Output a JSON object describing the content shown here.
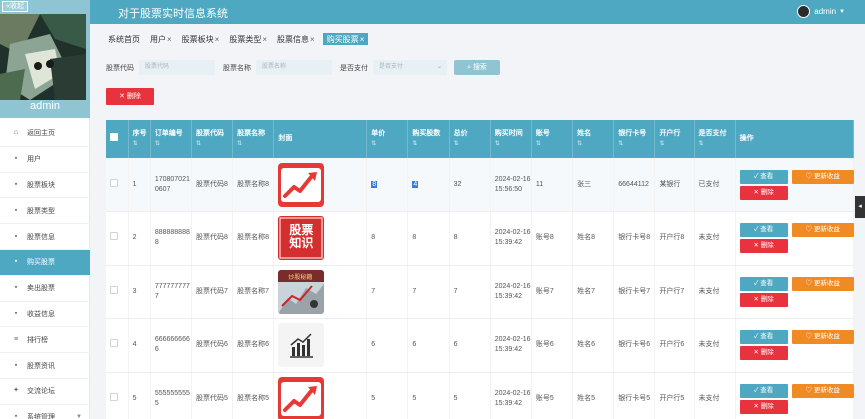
{
  "app": {
    "title": "对于股票实时信息系统",
    "user": "admin"
  },
  "sidebar": {
    "collapse_label": "«收起",
    "admin_name": "admin",
    "items": [
      {
        "label": "返回主页",
        "icon": "home-icon"
      },
      {
        "label": "用户",
        "icon": "user-icon"
      },
      {
        "label": "股票板块",
        "icon": "board-icon"
      },
      {
        "label": "股票类型",
        "icon": "type-icon"
      },
      {
        "label": "股票信息",
        "icon": "info-icon"
      },
      {
        "label": "购买股票",
        "icon": "buy-icon",
        "active": true
      },
      {
        "label": "卖出股票",
        "icon": "sell-icon"
      },
      {
        "label": "收益信息",
        "icon": "income-icon"
      },
      {
        "label": "排行榜",
        "icon": "rank-icon"
      },
      {
        "label": "股票资讯",
        "icon": "news-icon"
      },
      {
        "label": "交流论坛",
        "icon": "forum-icon"
      },
      {
        "label": "系统管理",
        "icon": "settings-icon",
        "caret": true
      }
    ]
  },
  "tabs": [
    {
      "label": "系统首页",
      "closable": false
    },
    {
      "label": "用户",
      "closable": true
    },
    {
      "label": "股票板块",
      "closable": true
    },
    {
      "label": "股票类型",
      "closable": true
    },
    {
      "label": "股票信息",
      "closable": true
    },
    {
      "label": "购买股票",
      "closable": true,
      "active": true
    }
  ],
  "search": {
    "code_label": "股票代码",
    "code_placeholder": "股票代码",
    "name_label": "股票名称",
    "name_placeholder": "股票名称",
    "paid_label": "是否支付",
    "paid_placeholder": "是否支付",
    "search_button": "搜索"
  },
  "delete_button": "删除",
  "table": {
    "headers": [
      "序号",
      "订单编号",
      "股票代码",
      "股票名称",
      "封面",
      "单价",
      "购买股数",
      "总价",
      "购买时间",
      "账号",
      "姓名",
      "银行卡号",
      "开户行",
      "是否支付",
      "操作"
    ],
    "rows": [
      {
        "seq": "1",
        "order": "1708070210607",
        "code": "股票代码8",
        "name": "股票名称8",
        "cover": "chart",
        "price": "8",
        "shares": "4",
        "total": "32",
        "time": "2024-02-16 15:56:50",
        "account": "11",
        "realname": "张三",
        "card": "66644112",
        "bank": "某银行",
        "paid": "已支付"
      },
      {
        "seq": "2",
        "order": "8888888888",
        "code": "股票代码8",
        "name": "股票名称8",
        "cover": "text",
        "price": "8",
        "shares": "8",
        "total": "8",
        "time": "2024-02-16 15:39:42",
        "account": "账号8",
        "realname": "姓名8",
        "card": "银行卡号8",
        "bank": "开户行8",
        "paid": "未支付"
      },
      {
        "seq": "3",
        "order": "7777777777",
        "code": "股票代码7",
        "name": "股票名称7",
        "cover": "photo",
        "price": "7",
        "shares": "7",
        "total": "7",
        "time": "2024-02-16 15:39:42",
        "account": "账号7",
        "realname": "姓名7",
        "card": "银行卡号7",
        "bank": "开户行7",
        "paid": "未支付"
      },
      {
        "seq": "4",
        "order": "6666666666",
        "code": "股票代码6",
        "name": "股票名称6",
        "cover": "icon",
        "price": "6",
        "shares": "6",
        "total": "6",
        "time": "2024-02-16 15:39:42",
        "account": "账号6",
        "realname": "姓名6",
        "card": "银行卡号6",
        "bank": "开户行6",
        "paid": "未支付"
      },
      {
        "seq": "5",
        "order": "5555555555",
        "code": "股票代码5",
        "name": "股票名称5",
        "cover": "chart",
        "price": "5",
        "shares": "5",
        "total": "5",
        "time": "2024-02-16 15:39:42",
        "account": "账号5",
        "realname": "姓名5",
        "card": "银行卡号5",
        "bank": "开户行5",
        "paid": "未支付"
      }
    ],
    "cover_text": "股票知识",
    "cover_photo_text": "炒股秘籍",
    "actions": {
      "view": "查看",
      "update": "更新收益",
      "delete": "删除"
    }
  },
  "colors": {
    "primary": "#4fa8c2",
    "danger": "#e8323e",
    "warning": "#f08a24"
  }
}
